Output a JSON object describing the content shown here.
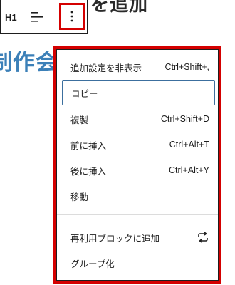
{
  "background": {
    "top_text": "を追加",
    "heading": "制作会社"
  },
  "toolbar": {
    "block_type_label": "H1"
  },
  "menu": {
    "items": [
      {
        "label": "追加設定を非表示",
        "shortcut": "Ctrl+Shift+,"
      },
      {
        "label": "コピー",
        "shortcut": ""
      },
      {
        "label": "複製",
        "shortcut": "Ctrl+Shift+D"
      },
      {
        "label": "前に挿入",
        "shortcut": "Ctrl+Alt+T"
      },
      {
        "label": "後に挿入",
        "shortcut": "Ctrl+Alt+Y"
      },
      {
        "label": "移動",
        "shortcut": ""
      }
    ],
    "group2": [
      {
        "label": "再利用ブロックに追加",
        "icon": "reusable-block-icon"
      },
      {
        "label": "グループ化"
      }
    ]
  },
  "colors": {
    "highlight": "#d40000",
    "focus_outline": "#3c6f9e",
    "heading_blue": "#3c80b8"
  }
}
